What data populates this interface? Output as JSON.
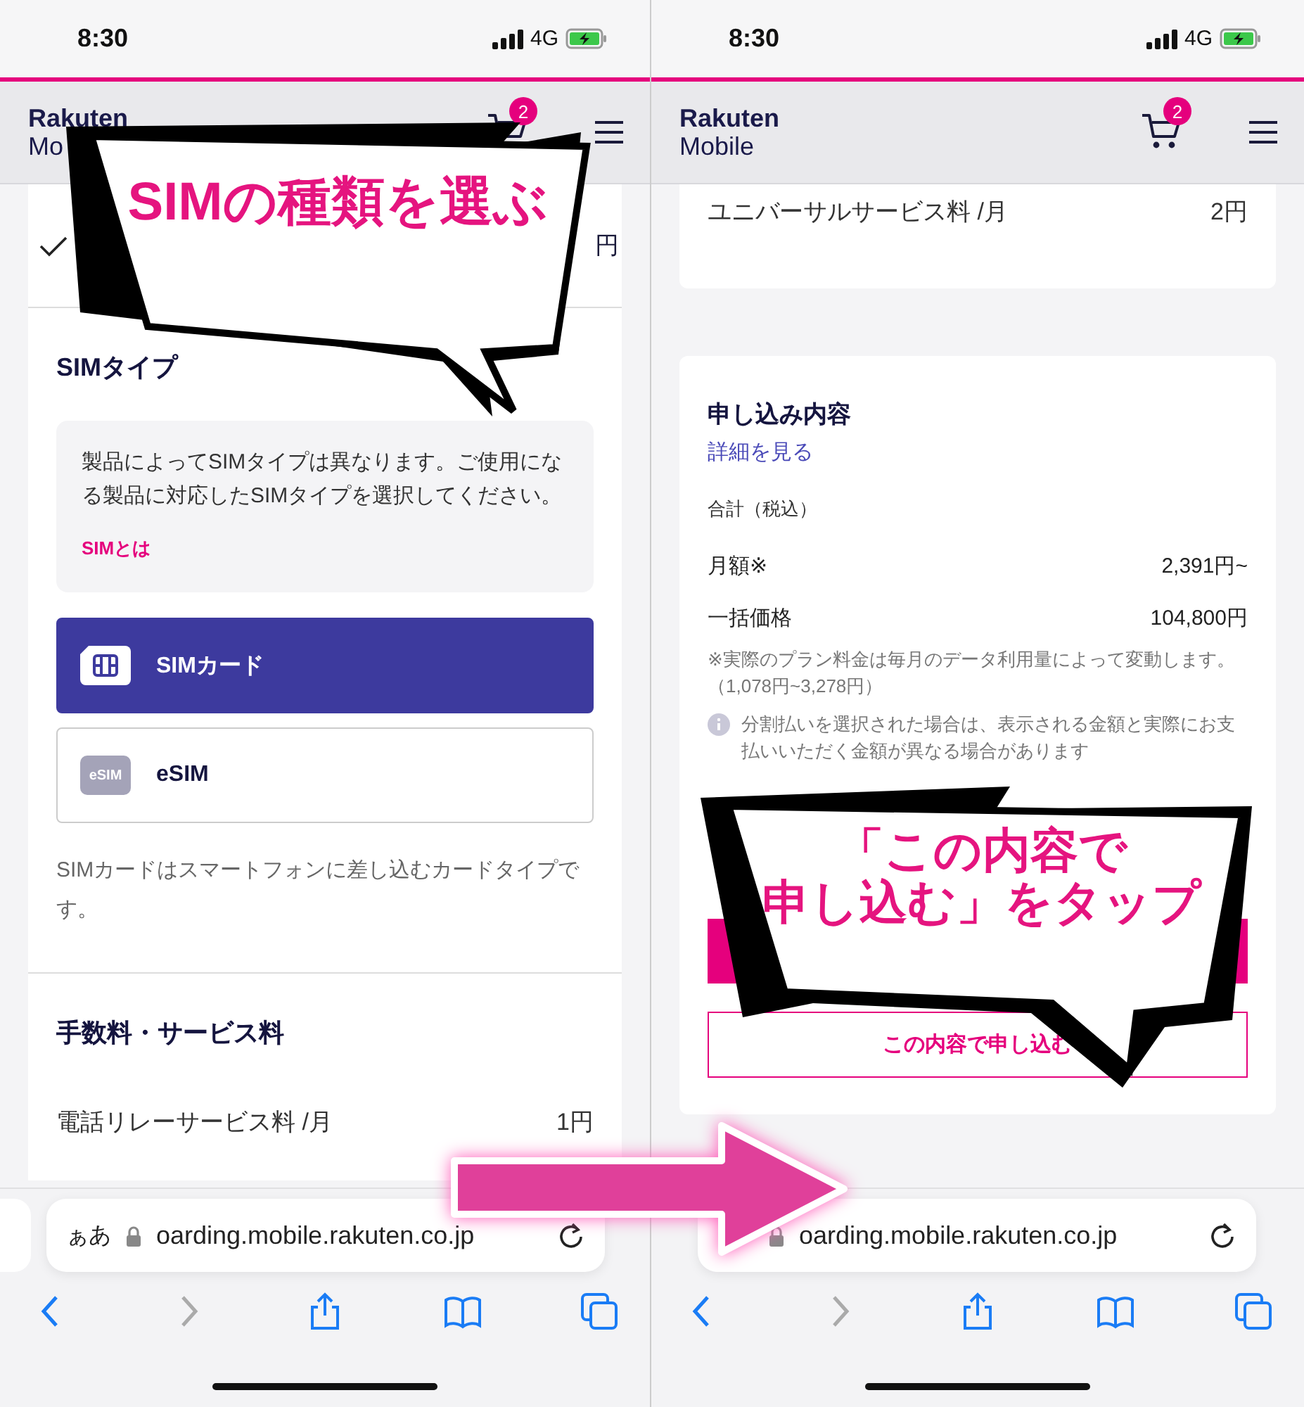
{
  "left_screen": {
    "status_bar": {
      "time": "8:30",
      "network": "4G"
    },
    "header": {
      "logo": [
        "Rakuten",
        "Mo"
      ],
      "cart_badge": "2"
    },
    "plan_row": {
      "checked": true,
      "price": "円"
    },
    "sim_type": {
      "title": "SIMタイプ",
      "info": {
        "text": "製品によってSIMタイプは異なります。ご使用になる製品に対応したSIMタイプを選択してください。",
        "link": "SIMとは"
      },
      "options": [
        {
          "kind": "sim",
          "label": "SIMカード",
          "selected": true
        },
        {
          "kind": "esim",
          "icon_label": "eSIM",
          "label": "eSIM",
          "selected": false
        }
      ],
      "description": "SIMカードはスマートフォンに差し込むカードタイプです。"
    },
    "fees": {
      "title": "手数料・サービス料",
      "rows": [
        {
          "label": "電話リレーサービス料 /月",
          "value": "1円"
        }
      ]
    },
    "browser": {
      "text_size": "ぁあ",
      "url": "oarding.mobile.rakuten.co.jp",
      "toolbar": [
        {
          "kind": "back",
          "disabled": false
        },
        {
          "kind": "forward",
          "disabled": true
        },
        {
          "kind": "share",
          "disabled": false
        },
        {
          "kind": "bookmarks",
          "disabled": false
        },
        {
          "kind": "tabs",
          "disabled": false
        }
      ]
    }
  },
  "right_screen": {
    "status_bar": {
      "time": "8:30",
      "network": "4G"
    },
    "header": {
      "logo": [
        "Rakuten",
        "Mobile"
      ],
      "cart_badge": "2"
    },
    "fee_row": {
      "label": "ユニバーサルサービス料 /月",
      "value": "2円"
    },
    "summary": {
      "title": "申し込み内容",
      "details_link": "詳細を見る",
      "total_label": "合計（税込）",
      "rows": [
        {
          "label": "月額※",
          "value": "2,391円~"
        },
        {
          "label": "一括価格",
          "value": "104,800円"
        }
      ],
      "note": "※実際のプラン料金は毎月のデータ利用量によって変動します。（1,078円~3,278円）",
      "info_note": "分割払いを選択された場合は、表示される金額と実際にお支払いいただく金額が異なる場合があります",
      "apply_button": "この内容で申し込む"
    },
    "browser": {
      "url": "oarding.mobile.rakuten.co.jp",
      "toolbar": [
        {
          "kind": "back",
          "disabled": false
        },
        {
          "kind": "forward",
          "disabled": true
        },
        {
          "kind": "share",
          "disabled": false
        },
        {
          "kind": "bookmarks",
          "disabled": false
        },
        {
          "kind": "tabs",
          "disabled": false
        }
      ]
    }
  },
  "callouts": [
    {
      "lines": [
        "SIMの種類を選ぶ"
      ]
    },
    {
      "lines": [
        "「この内容で",
        "申し込む」をタップ"
      ]
    }
  ]
}
